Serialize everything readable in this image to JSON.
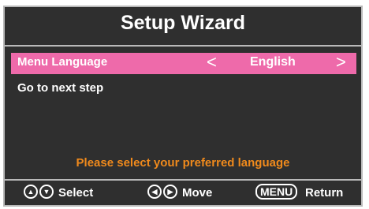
{
  "title": "Setup Wizard",
  "menu": {
    "language_label": "Menu Language",
    "language_value": "English",
    "next_step_label": "Go to next step"
  },
  "hint": "Please select your preferred language",
  "footer": {
    "select_label": "Select",
    "move_label": "Move",
    "menu_key": "MENU",
    "return_label": "Return"
  },
  "colors": {
    "background": "#2f2f2f",
    "highlight": "#ee6aaa",
    "hint": "#f08a1c",
    "border": "#b9b9b9"
  },
  "icons": {
    "up": "up-circle-icon",
    "down": "down-circle-icon",
    "left": "left-circle-icon",
    "right": "right-circle-icon"
  }
}
